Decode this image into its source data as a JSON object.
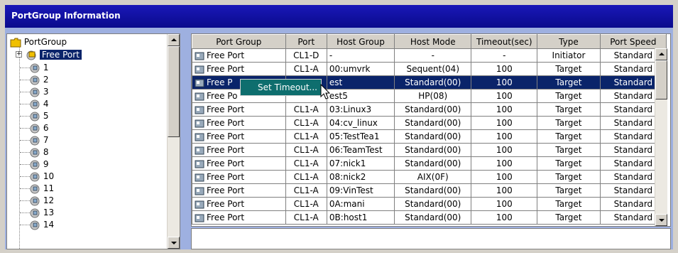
{
  "window": {
    "title": "PortGroup Information"
  },
  "tree": {
    "root_label": "PortGroup",
    "selected_label": "Free Port",
    "items": [
      "1",
      "2",
      "3",
      "4",
      "5",
      "6",
      "7",
      "8",
      "9",
      "10",
      "11",
      "12",
      "13",
      "14"
    ]
  },
  "table": {
    "columns": [
      "Port Group",
      "Port",
      "Host Group",
      "Host Mode",
      "Timeout(sec)",
      "Type",
      "Port Speed"
    ],
    "rows": [
      [
        "Free Port",
        "CL1-D",
        "-",
        "-",
        "-",
        "Initiator",
        "Standard"
      ],
      [
        "Free Port",
        "CL1-A",
        "00:umvrk",
        "Sequent(04)",
        "100",
        "Target",
        "Standard"
      ],
      [
        "Free P",
        "",
        "est",
        "Standard(00)",
        "100",
        "Target",
        "Standard"
      ],
      [
        "Free Po",
        "",
        "est5",
        "HP(08)",
        "100",
        "Target",
        "Standard"
      ],
      [
        "Free Port",
        "CL1-A",
        "03:Linux3",
        "Standard(00)",
        "100",
        "Target",
        "Standard"
      ],
      [
        "Free Port",
        "CL1-A",
        "04:cv_linux",
        "Standard(00)",
        "100",
        "Target",
        "Standard"
      ],
      [
        "Free Port",
        "CL1-A",
        "05:TestTea1",
        "Standard(00)",
        "100",
        "Target",
        "Standard"
      ],
      [
        "Free Port",
        "CL1-A",
        "06:TeamTest",
        "Standard(00)",
        "100",
        "Target",
        "Standard"
      ],
      [
        "Free Port",
        "CL1-A",
        "07:nick1",
        "Standard(00)",
        "100",
        "Target",
        "Standard"
      ],
      [
        "Free Port",
        "CL1-A",
        "08:nick2",
        "AIX(0F)",
        "100",
        "Target",
        "Standard"
      ],
      [
        "Free Port",
        "CL1-A",
        "09:VinTest",
        "Standard(00)",
        "100",
        "Target",
        "Standard"
      ],
      [
        "Free Port",
        "CL1-A",
        "0A:mani",
        "Standard(00)",
        "100",
        "Target",
        "Standard"
      ],
      [
        "Free Port",
        "CL1-A",
        "0B:host1",
        "Standard(00)",
        "100",
        "Target",
        "Standard"
      ]
    ],
    "selected_row": 2
  },
  "context_menu": {
    "item": "Set Timeout..."
  },
  "colors": {
    "title_bg": "#0a0a8c",
    "selection": "#0a246a",
    "menu_bg": "#0e6e6e",
    "panel_bg": "#9eb0e0"
  }
}
